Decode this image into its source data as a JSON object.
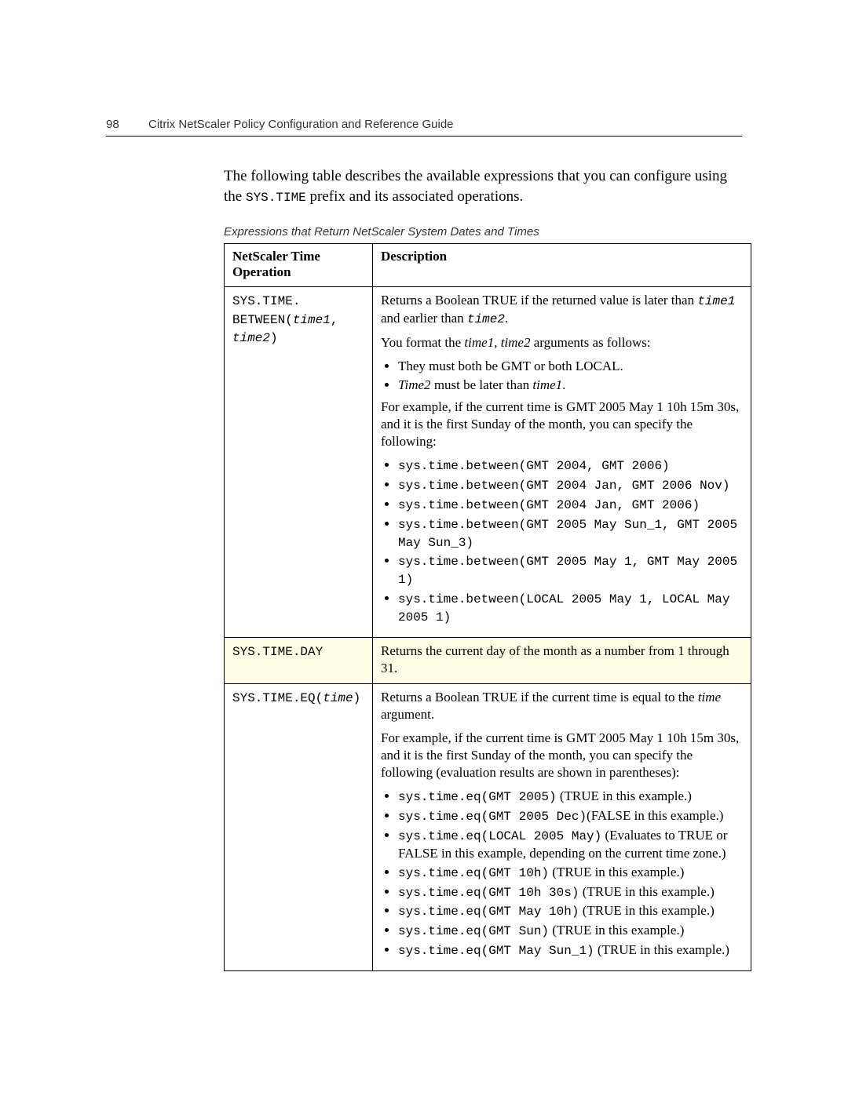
{
  "header": {
    "page_number": "98",
    "title": "Citrix NetScaler Policy Configuration and Reference Guide"
  },
  "intro": {
    "line1_pre": "The following table describes the available expressions that you can configure using the ",
    "line1_code": "SYS.TIME",
    "line1_post": " prefix and its associated operations."
  },
  "caption": "Expressions that Return NetScaler System Dates and Times",
  "table": {
    "head_col1": "NetScaler Time Operation",
    "head_col2": "Description",
    "row1": {
      "op_a": "SYS.TIME.",
      "op_b": "BETWEEN(",
      "op_c": "time1",
      "op_d": ",",
      "op_e": "time2",
      "op_f": ")",
      "p1_a": "Returns a Boolean TRUE if the returned value is later than ",
      "p1_b": "time1",
      "p1_c": " and earlier than ",
      "p1_d": "time2",
      "p1_e": ".",
      "p2_a": "You format the ",
      "p2_b": "time1, time2",
      "p2_c": " arguments as follows:",
      "b1": "They must both be GMT or both LOCAL.",
      "b2_a": "Time2",
      "b2_b": " must be later than ",
      "b2_c": "time1",
      "b2_d": ".",
      "p3": "For example, if the current time is GMT 2005 May 1 10h 15m 30s, and it is the first Sunday of the month, you can specify the following:",
      "e1": "sys.time.between(GMT 2004, GMT 2006)",
      "e2": "sys.time.between(GMT 2004 Jan, GMT 2006 Nov)",
      "e3": "sys.time.between(GMT 2004 Jan, GMT 2006)",
      "e4": "sys.time.between(GMT 2005 May Sun_1, GMT 2005 May Sun_3)",
      "e5": "sys.time.between(GMT 2005 May 1, GMT May 2005 1)",
      "e6": "sys.time.between(LOCAL 2005 May 1, LOCAL May 2005 1)"
    },
    "row2": {
      "op": "SYS.TIME.DAY",
      "desc": "Returns the current day of the month as a number from 1 through 31."
    },
    "row3": {
      "op_a": "SYS.TIME.EQ(",
      "op_b": "time",
      "op_c": ")",
      "p1_a": "Returns a Boolean TRUE if the current time is equal to the ",
      "p1_b": "time",
      "p1_c": " argument.",
      "p2": "For example, if the current time is GMT 2005 May 1 10h 15m 30s, and it is the first Sunday of the month, you can specify the following (evaluation results are shown in parentheses):",
      "e1_code": "sys.time.eq(GMT 2005)",
      "e1_txt": " (TRUE in this example.)",
      "e2_code": "sys.time.eq(GMT 2005 Dec)",
      "e2_txt": "(FALSE in this example.)",
      "e3_code": "sys.time.eq(LOCAL 2005 May)",
      "e3_txt": "  (Evaluates to TRUE or FALSE in this example, depending on the current time zone.)",
      "e4_code": "sys.time.eq(GMT 10h)",
      "e4_txt": " (TRUE in this example.)",
      "e5_code": "sys.time.eq(GMT 10h 30s)",
      "e5_txt": "  (TRUE in this example.)",
      "e6_code": "sys.time.eq(GMT May 10h)",
      "e6_txt": "  (TRUE in this example.)",
      "e7_code": "sys.time.eq(GMT Sun)",
      "e7_txt": "  (TRUE in this example.)",
      "e8_code": "sys.time.eq(GMT May Sun_1)",
      "e8_txt": " (TRUE in this example.)"
    }
  }
}
